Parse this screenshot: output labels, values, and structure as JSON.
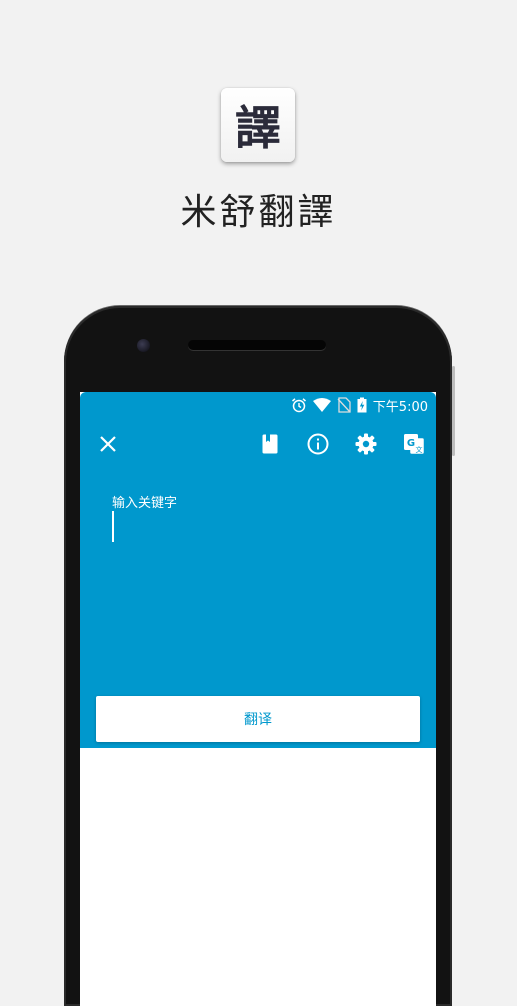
{
  "promo": {
    "app_icon_glyph": "譯",
    "app_name": "米舒翻譯"
  },
  "status_bar": {
    "time": "下午5:00",
    "icons": [
      "alarm-icon",
      "wifi-icon",
      "no-sim-icon",
      "battery-charging-icon"
    ]
  },
  "toolbar": {
    "close_icon": "close-icon",
    "actions": [
      "dictionary-book-icon",
      "info-icon",
      "settings-gear-icon",
      "google-translate-icon"
    ]
  },
  "editor": {
    "placeholder": "输入关键字"
  },
  "translate_button": {
    "label": "翻译"
  },
  "colors": {
    "accent": "#0098cd",
    "background": "#f2f2f2",
    "phone_body": "#121212"
  }
}
